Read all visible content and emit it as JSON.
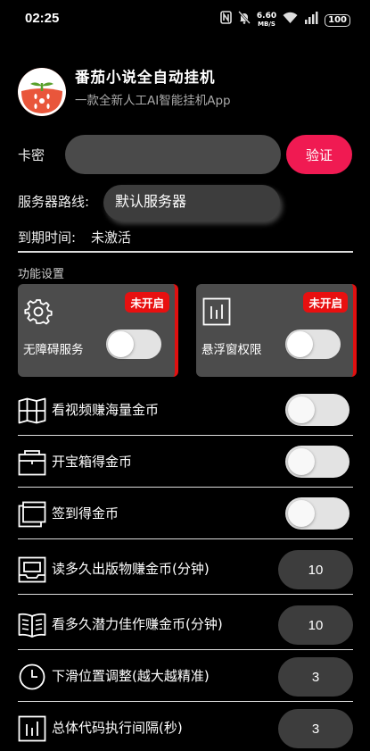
{
  "status_bar": {
    "time": "02:25",
    "net_speed_value": "6.60",
    "net_speed_unit": "MB/S",
    "battery": "100",
    "icons": [
      "nfc-icon",
      "mute-icon",
      "wifi-icon",
      "signal-icon",
      "battery-icon"
    ]
  },
  "app": {
    "title": "番茄小说全自动挂机",
    "subtitle": "一款全新人工AI智能挂机App"
  },
  "key": {
    "label": "卡密",
    "value": "",
    "verify_label": "验证"
  },
  "server": {
    "label": "服务器路线:",
    "selected": "默认服务器"
  },
  "expiry": {
    "label": "到期时间:",
    "value": "未激活"
  },
  "features": {
    "section_title": "功能设置",
    "cards": [
      {
        "label": "无障碍服务",
        "badge": "未开启",
        "icon": "gear-icon",
        "enabled": false
      },
      {
        "label": "悬浮窗权限",
        "badge": "未开启",
        "icon": "bar-chart-icon",
        "enabled": false
      }
    ]
  },
  "options": {
    "toggles": [
      {
        "label": "看视频赚海量金币",
        "icon": "map-icon",
        "enabled": false
      },
      {
        "label": "开宝箱得金币",
        "icon": "treasure-box-icon",
        "enabled": false
      },
      {
        "label": "签到得金币",
        "icon": "calendar-stack-icon",
        "enabled": false
      }
    ],
    "numbers": [
      {
        "label": "读多久出版物赚金币(分钟)",
        "icon": "inbox-icon",
        "value": "10"
      },
      {
        "label": "看多久潜力佳作赚金币(分钟)",
        "icon": "book-icon",
        "value": "10"
      },
      {
        "label": "下滑位置调整(越大越精准)",
        "icon": "clock-icon",
        "value": "3"
      },
      {
        "label": "总体代码执行间隔(秒)",
        "icon": "bar-chart-icon",
        "value": "3"
      }
    ]
  },
  "colors": {
    "background": "#000000",
    "accent": "#f01a52",
    "badge": "#e81010",
    "card": "#4c4c4c",
    "input": "#3d3d3d"
  }
}
